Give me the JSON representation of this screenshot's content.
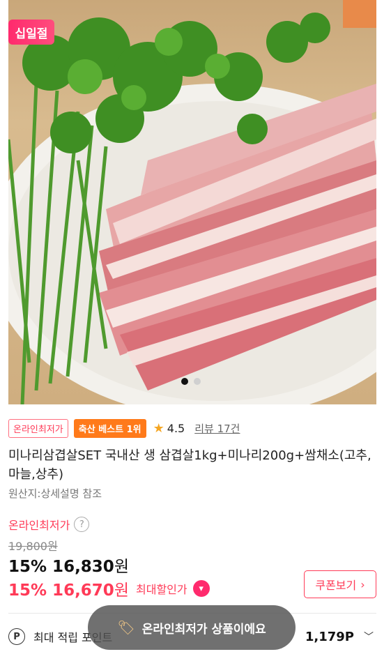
{
  "hero": {
    "sale_badge": "십일절",
    "dot_count": 2,
    "active_dot": 0
  },
  "tags": {
    "online_lowest": "온라인최저가",
    "category_best": "축산 베스트 1위",
    "rating": "4.5",
    "review": "리뷰 17건"
  },
  "product": {
    "title": "미나리삼겹살SET 국내산 생 삼겹살1kg+미나리200g+쌈채소(고추,마늘,상추)",
    "origin": "원산지:상세설명 참조"
  },
  "price": {
    "label": "온라인최저가",
    "original": "19,800원",
    "discount1": "15% 16,830",
    "currency": "원",
    "discount2": "15% 16,670",
    "max_discount_label": "최대할인가"
  },
  "coupon": {
    "label": "쿠폰보기"
  },
  "points": {
    "label": "최대 적립 포인트",
    "value": "1,179P"
  },
  "toast": {
    "message": "온라인최저가 상품이에요"
  },
  "colors": {
    "accent": "#ff3a57",
    "best": "#ff7a1a",
    "star": "#f5a623"
  },
  "icons": [
    "star-icon",
    "help-icon",
    "chevron-down-badge-icon",
    "chevron-right-icon",
    "point-icon",
    "chevron-down-icon",
    "tag-icon"
  ]
}
